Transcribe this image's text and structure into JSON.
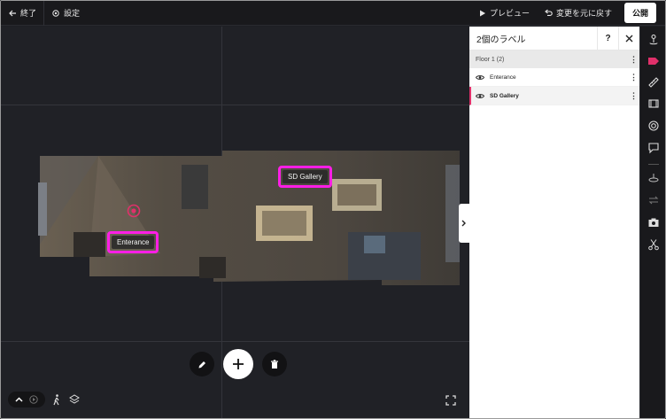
{
  "topbar": {
    "exit_label": "終了",
    "settings_label": "設定",
    "preview_label": "プレビュー",
    "undo_label": "変更を元に戻す",
    "publish_label": "公開"
  },
  "viewport": {
    "tags": [
      {
        "label": "SD Gallery"
      },
      {
        "label": "Enterance"
      }
    ]
  },
  "panel": {
    "title": "2個のラベル",
    "help_label": "?",
    "floor": {
      "label": "Floor 1",
      "count": "(2)"
    },
    "items": [
      {
        "label": "Enterance",
        "selected": false
      },
      {
        "label": "SD Gallery",
        "selected": true
      }
    ]
  },
  "colors": {
    "accent_magenta": "#ff1ee6",
    "active_red": "#e0306a",
    "topbar_bg": "#19191c",
    "viewport_bg": "#202126"
  },
  "icons": {
    "toolbar": [
      "user-pin-icon",
      "label-tag-icon",
      "ruler-icon",
      "film-icon",
      "target-icon",
      "comment-icon",
      "divider",
      "layers-icon",
      "swap-icon",
      "camera-icon",
      "scissors-icon"
    ]
  }
}
